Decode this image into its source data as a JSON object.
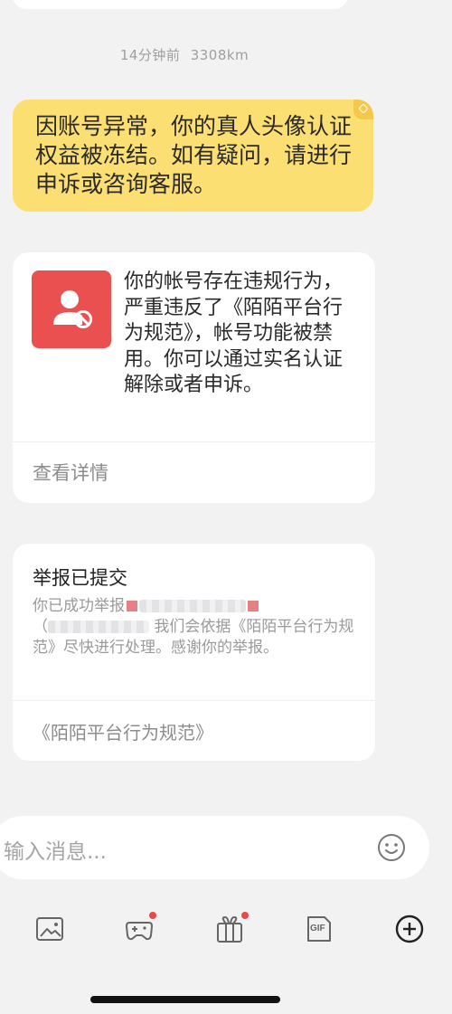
{
  "timestamp": {
    "time": "14分钟前",
    "distance": "3308km"
  },
  "system_bubble": {
    "text": "因账号异常，你的真人头像认证权益被冻结。如有疑问，请进行申诉或咨询客服。",
    "color": "#fbdf73"
  },
  "violation_card": {
    "icon": "user-ban-icon",
    "text": "你的帐号存在违规行为，严重违反了《陌陌平台行为规范》，帐号功能被禁用。你可以通过实名认证解除或者申诉。",
    "link_label": "查看详情",
    "badge_color": "#ea5050"
  },
  "report_card": {
    "title": "举报已提交",
    "body_start": "你已成功举报",
    "body_paren": "（",
    "body_end": "我们会依据《陌陌平台行为规范》尽快进行处理。感谢你的举报。",
    "link_label": "《陌陌平台行为规范》"
  },
  "input": {
    "placeholder": "输入消息..."
  },
  "toolbar": [
    {
      "icon": "image-icon"
    },
    {
      "icon": "game-controller-icon",
      "badge": true
    },
    {
      "icon": "gift-icon",
      "badge": true
    },
    {
      "icon": "gif-icon",
      "label": "GIF"
    },
    {
      "icon": "plus-circle-icon"
    }
  ],
  "colors": {
    "background": "#f2f2f3",
    "badge_dot": "#f04545"
  }
}
